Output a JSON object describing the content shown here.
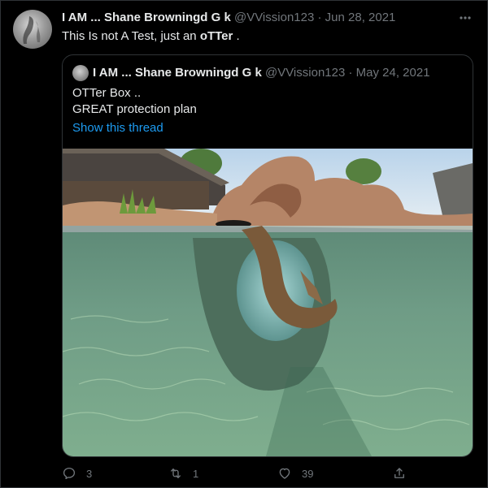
{
  "tweet": {
    "author_name": "I AM ... Shane Browningd G k",
    "handle": "@VVission123",
    "date": "Jun 28, 2021",
    "separator": "·",
    "text_prefix": "This Is not A Test, just an ",
    "text_bold": "oTTer",
    "text_suffix": " ."
  },
  "quoted": {
    "author_name": "I AM ... Shane Browningd G k",
    "handle": "@VVission123",
    "date": "May 24, 2021",
    "separator": "·",
    "line1": "OTTer Box ..",
    "line2": "GREAT protection plan",
    "show_thread": "Show this thread"
  },
  "actions": {
    "replies": "3",
    "retweets": "1",
    "likes": "39"
  },
  "icons": [
    "more-icon",
    "reply-icon",
    "retweet-icon",
    "like-icon",
    "share-icon"
  ],
  "colors": {
    "background": "#000000",
    "text": "#e7e9ea",
    "muted": "#71767b",
    "link": "#1d9bf0",
    "border": "#2f3336"
  }
}
